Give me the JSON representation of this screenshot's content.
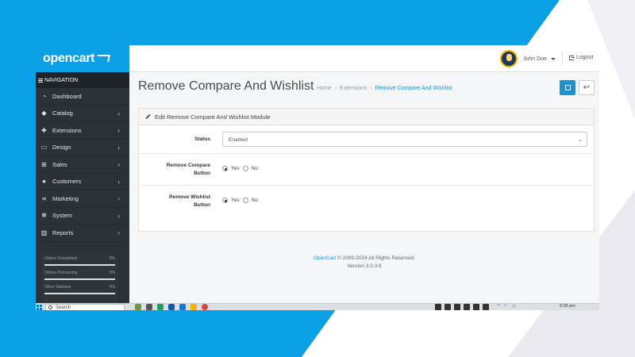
{
  "brand": {
    "logo_text": "opencart",
    "accent": "#0aa0e6",
    "link_color": "#1e91cf"
  },
  "header": {
    "user_name": "John Doe",
    "logout_label": "Logout"
  },
  "sidebar": {
    "nav_title": "NAVIGATION",
    "items": [
      {
        "label": "Dashboard",
        "icon": "dashboard-icon",
        "has_children": false
      },
      {
        "label": "Catalog",
        "icon": "tag-icon",
        "has_children": true
      },
      {
        "label": "Extensions",
        "icon": "puzzle-icon",
        "has_children": true
      },
      {
        "label": "Design",
        "icon": "monitor-icon",
        "has_children": true
      },
      {
        "label": "Sales",
        "icon": "cart-icon",
        "has_children": true
      },
      {
        "label": "Customers",
        "icon": "user-icon",
        "has_children": true
      },
      {
        "label": "Marketing",
        "icon": "share-icon",
        "has_children": true
      },
      {
        "label": "System",
        "icon": "cog-icon",
        "has_children": true
      },
      {
        "label": "Reports",
        "icon": "bar-chart-icon",
        "has_children": true
      }
    ],
    "stats": [
      {
        "label": "Orders Completed",
        "value": "0%"
      },
      {
        "label": "Orders Processing",
        "value": "0%"
      },
      {
        "label": "Other Statuses",
        "value": "0%"
      }
    ]
  },
  "page": {
    "title": "Remove Compare And Wishlist",
    "breadcrumbs": [
      "Home",
      "Extensions",
      "Remove Compare And Wishlist"
    ]
  },
  "panel": {
    "heading": "Edit Remove Compare And Wishlist Module",
    "status_label": "Status",
    "status_value": "Enabled",
    "compare_label": "Remove Compare Button",
    "compare_value": "Yes",
    "wishlist_label": "Remove Wishlist Button",
    "wishlist_value": "Yes",
    "yes_label": "Yes",
    "no_label": "No"
  },
  "footer": {
    "link_text": "OpenCart",
    "copyright": "© 2009-2024 All Rights Reserved.",
    "version": "Version 3.0.3.8"
  },
  "taskbar": {
    "search_placeholder": "Search",
    "time": "9:05 pm"
  }
}
